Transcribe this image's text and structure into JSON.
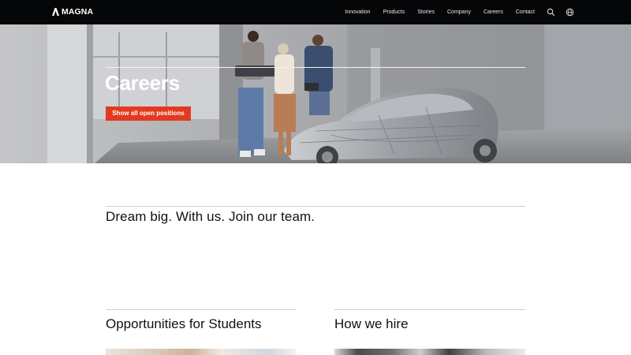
{
  "brand": {
    "name": "MAGNA"
  },
  "nav": {
    "items": [
      "Innovation",
      "Products",
      "Stories",
      "Company",
      "Careers",
      "Contact"
    ],
    "icons": [
      "search-icon",
      "globe-icon"
    ]
  },
  "hero": {
    "title": "Careers",
    "button_label": "Show all open positions",
    "button_color": "#e23a1f"
  },
  "main": {
    "tagline": "Dream big. With us. Join our team."
  },
  "sections": [
    {
      "title": "Opportunities for Students"
    },
    {
      "title": "How we hire"
    }
  ],
  "colors": {
    "nav_background": "#050608",
    "accent": "#e23a1f"
  }
}
